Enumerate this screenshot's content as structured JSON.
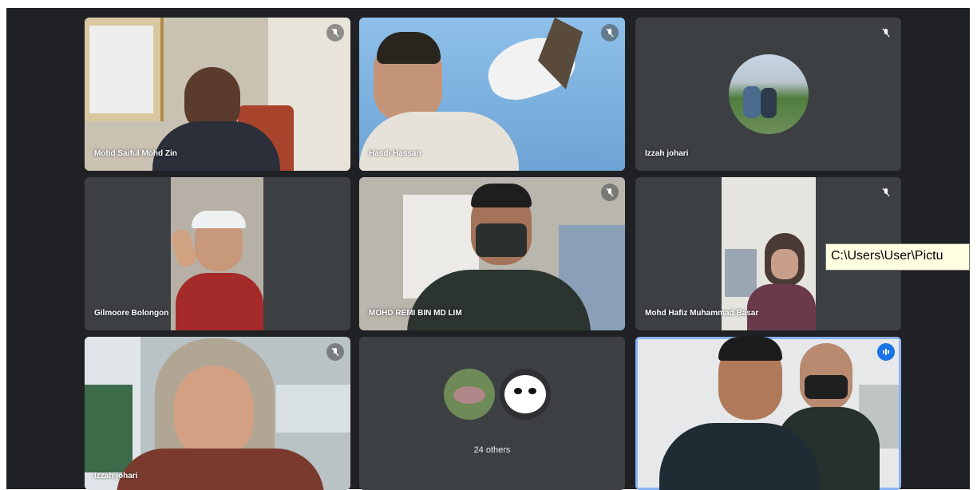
{
  "colors": {
    "background": "#202124",
    "tile": "#3c4043",
    "active_speaker": "#1a73e8",
    "tooltip_bg": "#ffffe1"
  },
  "tiles": [
    {
      "name": "Mohd Saiful Mohd Zin",
      "mic": "mic-muted-icon"
    },
    {
      "name": "Hasdi Hassan",
      "mic": "mic-muted-icon"
    },
    {
      "name": "Izzah johari",
      "mic": "mic-muted-icon"
    },
    {
      "name": "Gilmoore Bolongon",
      "mic": ""
    },
    {
      "name": "MOHD REMI BIN MD LIM",
      "mic": "mic-muted-icon"
    },
    {
      "name": "Mohd Hafiz Muhammad Basar",
      "mic": "mic-muted-icon"
    },
    {
      "name": "Izzah johari",
      "mic": "mic-muted-icon"
    },
    {
      "name": "",
      "mic": "",
      "others_label": "24 others"
    },
    {
      "name": "",
      "mic": "speaking-icon"
    }
  ],
  "tooltip": {
    "text": "C:\\Users\\User\\Pictu"
  }
}
